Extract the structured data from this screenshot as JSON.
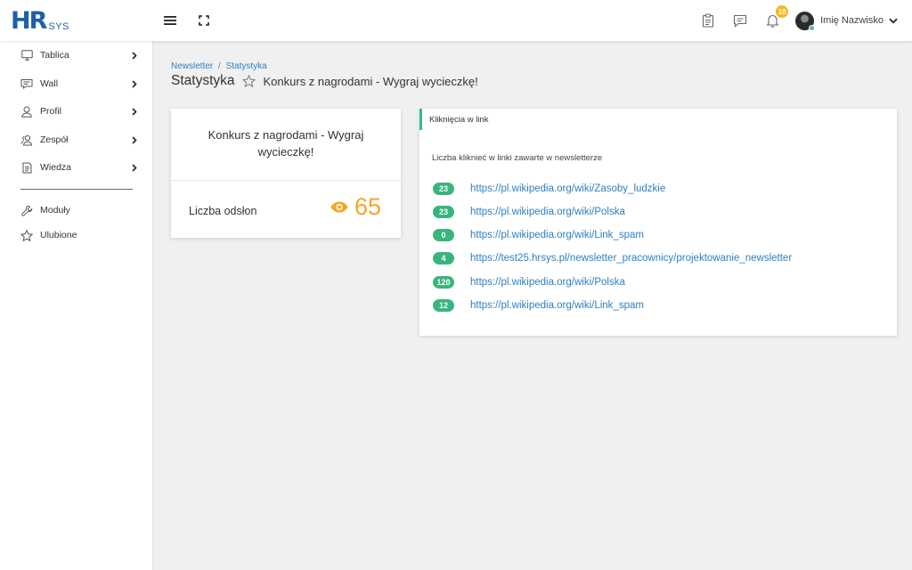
{
  "brand": {
    "logo_main": "HR",
    "logo_sub": "SYS"
  },
  "topbar": {
    "notifications_count": "10",
    "user_name": "Imię Nazwisko"
  },
  "sidebar": {
    "items": [
      {
        "label": "Tablica",
        "icon": "monitor-icon",
        "has_submenu": true
      },
      {
        "label": "Wall",
        "icon": "wall-icon",
        "has_submenu": true
      },
      {
        "label": "Profil",
        "icon": "user-icon",
        "has_submenu": true
      },
      {
        "label": "Zespół",
        "icon": "team-icon",
        "has_submenu": true
      },
      {
        "label": "Wiedza",
        "icon": "document-icon",
        "has_submenu": true
      }
    ],
    "secondary": [
      {
        "label": "Moduły",
        "icon": "wrench-icon"
      },
      {
        "label": "Ulubione",
        "icon": "star-icon"
      }
    ]
  },
  "breadcrumb": {
    "parent": "Newsletter",
    "separator": "/",
    "current": "Statystyka"
  },
  "page": {
    "title": "Statystyka",
    "subtitle": "Konkurs z nagrodami - Wygraj wycieczkę!"
  },
  "summary_card": {
    "title": "Konkurs z nagrodami - Wygraj wycieczkę!",
    "views_label": "Liczba odsłon",
    "views_value": "65",
    "accent_color": "#f5a623"
  },
  "clicks_card": {
    "header": "Kliknięcia w link",
    "description": "Liczba kliknieć w linki zawarte w newsletterze",
    "accent_color": "#3ab47e",
    "links": [
      {
        "count": "23",
        "url": "https://pl.wikipedia.org/wiki/Zasoby_ludzkie"
      },
      {
        "count": "23",
        "url": "https://pl.wikipedia.org/wiki/Polska"
      },
      {
        "count": "0",
        "url": "https://pl.wikipedia.org/wiki/Link_spam"
      },
      {
        "count": "4",
        "url": "https://test25.hrsys.pl/newsletter_pracownicy/projektowanie_newsletter"
      },
      {
        "count": "120",
        "url": "https://pl.wikipedia.org/wiki/Polska"
      },
      {
        "count": "12",
        "url": "https://pl.wikipedia.org/wiki/Link_spam"
      }
    ]
  }
}
